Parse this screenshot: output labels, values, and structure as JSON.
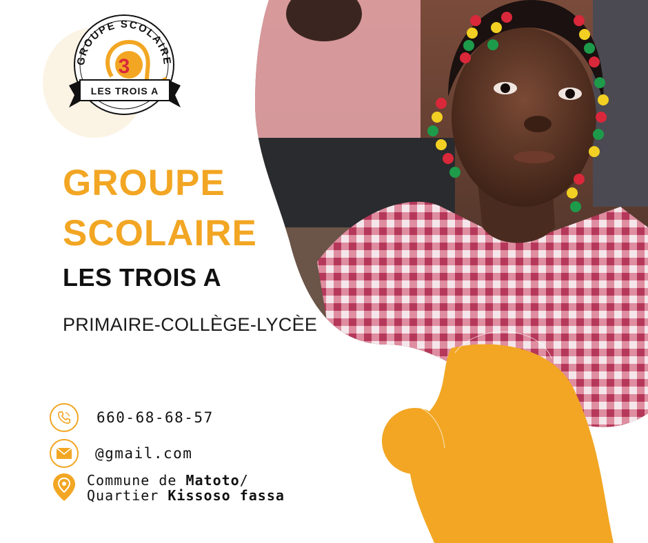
{
  "logo": {
    "arc_text": "GROUPE SCOLAIRE",
    "numeral": "3",
    "ribbon_text": "LES TROIS A"
  },
  "heading": {
    "line1": "GROUPE",
    "line2": "SCOLAIRE",
    "subtitle": "LES TROIS A",
    "levels": "PRIMAIRE-COLLÈGE-LYCÈE"
  },
  "contact": {
    "phone": "660-68-68-57",
    "email": "@gmail.com",
    "address_prefix1": "Commune de ",
    "address_commune": "Matoto",
    "address_sep": "/",
    "address_prefix2": "Quartier ",
    "address_quartier": "Kissoso fassa"
  },
  "icons": {
    "phone": "phone-icon",
    "mail": "mail-icon",
    "location": "location-pin-icon"
  },
  "colors": {
    "accent": "#f2a623",
    "text": "#111111"
  }
}
